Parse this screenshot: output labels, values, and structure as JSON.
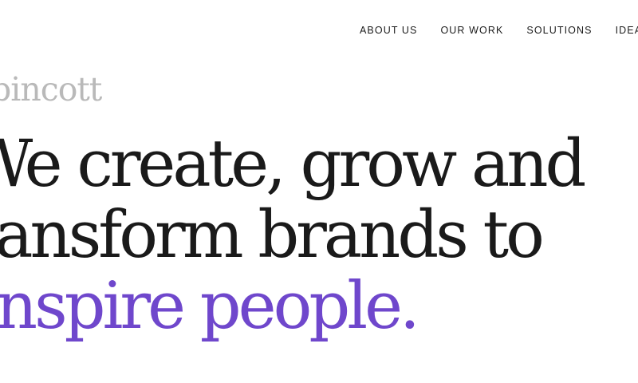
{
  "nav": {
    "items": [
      {
        "label": "ABOUT US"
      },
      {
        "label": "OUR WORK"
      },
      {
        "label": "SOLUTIONS"
      },
      {
        "label": "IDEAS"
      }
    ]
  },
  "logo": {
    "text": "pincott"
  },
  "hero": {
    "line1": "We create, grow and",
    "line2": "transform brands to",
    "line3": "inspire people."
  },
  "colors": {
    "accent": "#6f47cc",
    "text": "#1a1a1a",
    "logo": "#b9b9b9",
    "background": "#ffffff"
  }
}
